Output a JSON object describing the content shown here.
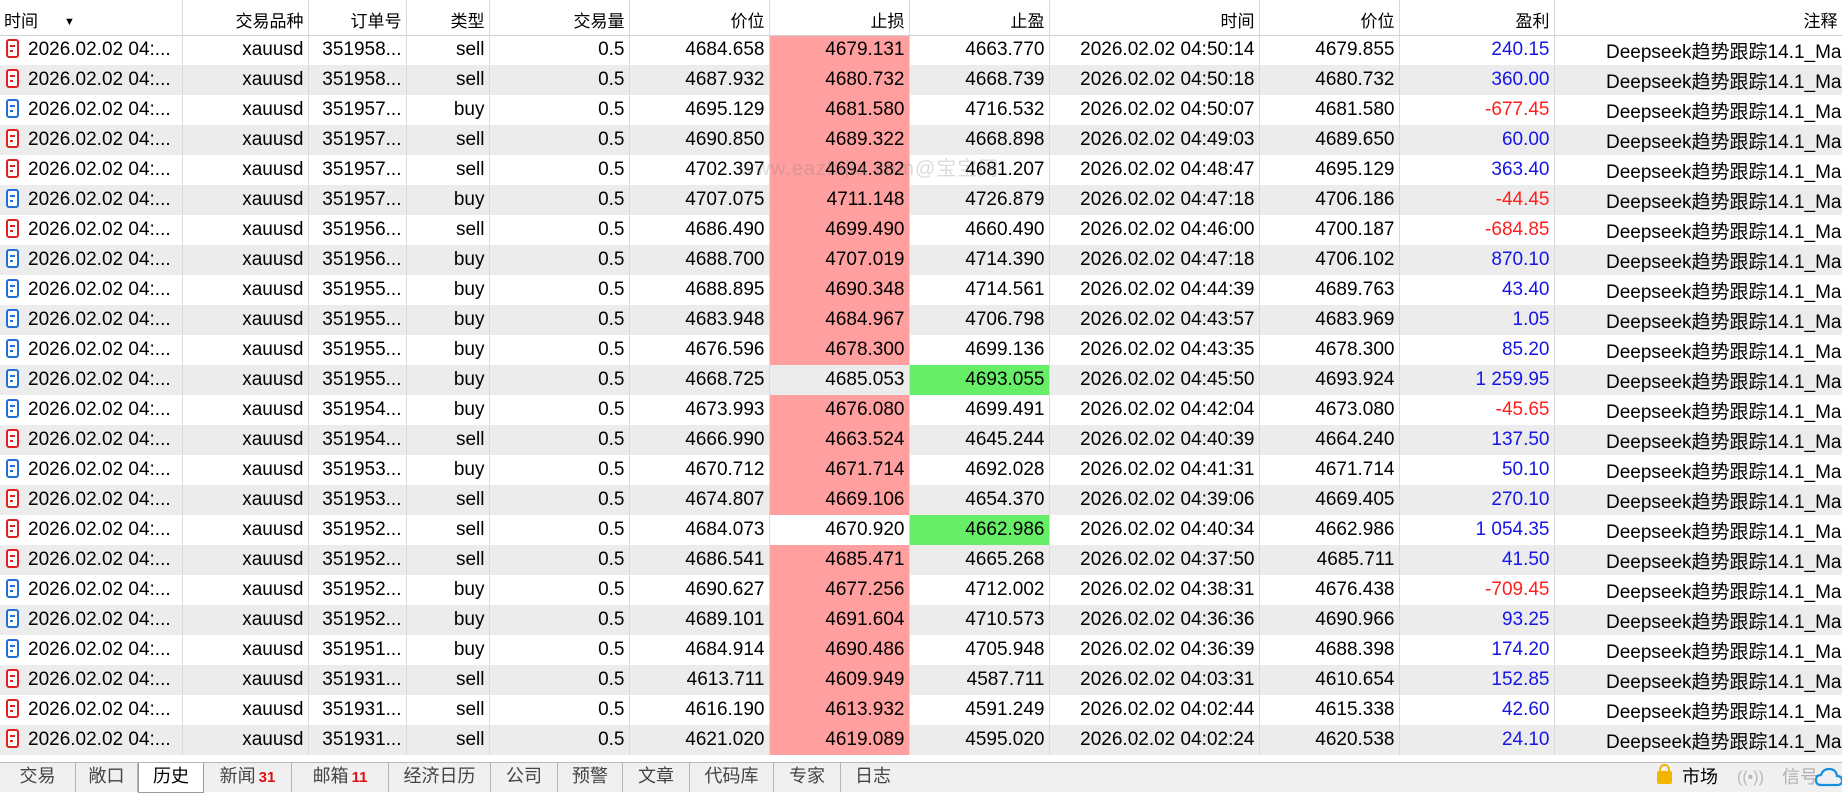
{
  "table": {
    "headers": {
      "time": "时间",
      "symbol": "交易品种",
      "ticket": "订单号",
      "type": "类型",
      "volume": "交易量",
      "price": "价位",
      "sl": "止损",
      "tp": "止盈",
      "close_time": "时间",
      "close_price": "价位",
      "profit": "盈利",
      "comment": "注释"
    },
    "rows": [
      {
        "time": "2026.02.02 04:...",
        "symbol": "xauusd",
        "ticket": "351958...",
        "type": "sell",
        "volume": "0.5",
        "price": "4684.658",
        "sl": "4679.131",
        "tp": "4663.770",
        "close_time": "2026.02.02 04:50:14",
        "close_price": "4679.855",
        "profit": "240.15",
        "comment": "Deepseek趋势跟踪14.1_Ma",
        "closed_by": "sl",
        "profit_sign": "pos"
      },
      {
        "time": "2026.02.02 04:...",
        "symbol": "xauusd",
        "ticket": "351958...",
        "type": "sell",
        "volume": "0.5",
        "price": "4687.932",
        "sl": "4680.732",
        "tp": "4668.739",
        "close_time": "2026.02.02 04:50:18",
        "close_price": "4680.732",
        "profit": "360.00",
        "comment": "Deepseek趋势跟踪14.1_Ma",
        "closed_by": "sl",
        "profit_sign": "pos"
      },
      {
        "time": "2026.02.02 04:...",
        "symbol": "xauusd",
        "ticket": "351957...",
        "type": "buy",
        "volume": "0.5",
        "price": "4695.129",
        "sl": "4681.580",
        "tp": "4716.532",
        "close_time": "2026.02.02 04:50:07",
        "close_price": "4681.580",
        "profit": "-677.45",
        "comment": "Deepseek趋势跟踪14.1_Ma",
        "closed_by": "sl",
        "profit_sign": "neg"
      },
      {
        "time": "2026.02.02 04:...",
        "symbol": "xauusd",
        "ticket": "351957...",
        "type": "sell",
        "volume": "0.5",
        "price": "4690.850",
        "sl": "4689.322",
        "tp": "4668.898",
        "close_time": "2026.02.02 04:49:03",
        "close_price": "4689.650",
        "profit": "60.00",
        "comment": "Deepseek趋势跟踪14.1_Ma",
        "closed_by": "sl",
        "profit_sign": "pos"
      },
      {
        "time": "2026.02.02 04:...",
        "symbol": "xauusd",
        "ticket": "351957...",
        "type": "sell",
        "volume": "0.5",
        "price": "4702.397",
        "sl": "4694.382",
        "tp": "4681.207",
        "close_time": "2026.02.02 04:48:47",
        "close_price": "4695.129",
        "profit": "363.40",
        "comment": "Deepseek趋势跟踪14.1_Ma",
        "closed_by": "sl",
        "profit_sign": "pos"
      },
      {
        "time": "2026.02.02 04:...",
        "symbol": "xauusd",
        "ticket": "351957...",
        "type": "buy",
        "volume": "0.5",
        "price": "4707.075",
        "sl": "4711.148",
        "tp": "4726.879",
        "close_time": "2026.02.02 04:47:18",
        "close_price": "4706.186",
        "profit": "-44.45",
        "comment": "Deepseek趋势跟踪14.1_Ma",
        "closed_by": "sl",
        "profit_sign": "neg"
      },
      {
        "time": "2026.02.02 04:...",
        "symbol": "xauusd",
        "ticket": "351956...",
        "type": "sell",
        "volume": "0.5",
        "price": "4686.490",
        "sl": "4699.490",
        "tp": "4660.490",
        "close_time": "2026.02.02 04:46:00",
        "close_price": "4700.187",
        "profit": "-684.85",
        "comment": "Deepseek趋势跟踪14.1_Ma",
        "closed_by": "sl",
        "profit_sign": "neg"
      },
      {
        "time": "2026.02.02 04:...",
        "symbol": "xauusd",
        "ticket": "351956...",
        "type": "buy",
        "volume": "0.5",
        "price": "4688.700",
        "sl": "4707.019",
        "tp": "4714.390",
        "close_time": "2026.02.02 04:47:18",
        "close_price": "4706.102",
        "profit": "870.10",
        "comment": "Deepseek趋势跟踪14.1_Ma",
        "closed_by": "sl",
        "profit_sign": "pos"
      },
      {
        "time": "2026.02.02 04:...",
        "symbol": "xauusd",
        "ticket": "351955...",
        "type": "buy",
        "volume": "0.5",
        "price": "4688.895",
        "sl": "4690.348",
        "tp": "4714.561",
        "close_time": "2026.02.02 04:44:39",
        "close_price": "4689.763",
        "profit": "43.40",
        "comment": "Deepseek趋势跟踪14.1_Ma",
        "closed_by": "sl",
        "profit_sign": "pos"
      },
      {
        "time": "2026.02.02 04:...",
        "symbol": "xauusd",
        "ticket": "351955...",
        "type": "buy",
        "volume": "0.5",
        "price": "4683.948",
        "sl": "4684.967",
        "tp": "4706.798",
        "close_time": "2026.02.02 04:43:57",
        "close_price": "4683.969",
        "profit": "1.05",
        "comment": "Deepseek趋势跟踪14.1_Ma",
        "closed_by": "sl",
        "profit_sign": "pos"
      },
      {
        "time": "2026.02.02 04:...",
        "symbol": "xauusd",
        "ticket": "351955...",
        "type": "buy",
        "volume": "0.5",
        "price": "4676.596",
        "sl": "4678.300",
        "tp": "4699.136",
        "close_time": "2026.02.02 04:43:35",
        "close_price": "4678.300",
        "profit": "85.20",
        "comment": "Deepseek趋势跟踪14.1_Ma",
        "closed_by": "sl",
        "profit_sign": "pos"
      },
      {
        "time": "2026.02.02 04:...",
        "symbol": "xauusd",
        "ticket": "351955...",
        "type": "buy",
        "volume": "0.5",
        "price": "4668.725",
        "sl": "4685.053",
        "tp": "4693.055",
        "close_time": "2026.02.02 04:45:50",
        "close_price": "4693.924",
        "profit": "1 259.95",
        "comment": "Deepseek趋势跟踪14.1_Ma",
        "closed_by": "tp",
        "profit_sign": "pos"
      },
      {
        "time": "2026.02.02 04:...",
        "symbol": "xauusd",
        "ticket": "351954...",
        "type": "buy",
        "volume": "0.5",
        "price": "4673.993",
        "sl": "4676.080",
        "tp": "4699.491",
        "close_time": "2026.02.02 04:42:04",
        "close_price": "4673.080",
        "profit": "-45.65",
        "comment": "Deepseek趋势跟踪14.1_Ma",
        "closed_by": "sl",
        "profit_sign": "neg"
      },
      {
        "time": "2026.02.02 04:...",
        "symbol": "xauusd",
        "ticket": "351954...",
        "type": "sell",
        "volume": "0.5",
        "price": "4666.990",
        "sl": "4663.524",
        "tp": "4645.244",
        "close_time": "2026.02.02 04:40:39",
        "close_price": "4664.240",
        "profit": "137.50",
        "comment": "Deepseek趋势跟踪14.1_Ma",
        "closed_by": "sl",
        "profit_sign": "pos"
      },
      {
        "time": "2026.02.02 04:...",
        "symbol": "xauusd",
        "ticket": "351953...",
        "type": "buy",
        "volume": "0.5",
        "price": "4670.712",
        "sl": "4671.714",
        "tp": "4692.028",
        "close_time": "2026.02.02 04:41:31",
        "close_price": "4671.714",
        "profit": "50.10",
        "comment": "Deepseek趋势跟踪14.1_Ma",
        "closed_by": "sl",
        "profit_sign": "pos"
      },
      {
        "time": "2026.02.02 04:...",
        "symbol": "xauusd",
        "ticket": "351953...",
        "type": "sell",
        "volume": "0.5",
        "price": "4674.807",
        "sl": "4669.106",
        "tp": "4654.370",
        "close_time": "2026.02.02 04:39:06",
        "close_price": "4669.405",
        "profit": "270.10",
        "comment": "Deepseek趋势跟踪14.1_Ma",
        "closed_by": "sl",
        "profit_sign": "pos"
      },
      {
        "time": "2026.02.02 04:...",
        "symbol": "xauusd",
        "ticket": "351952...",
        "type": "sell",
        "volume": "0.5",
        "price": "4684.073",
        "sl": "4670.920",
        "tp": "4662.986",
        "close_time": "2026.02.02 04:40:34",
        "close_price": "4662.986",
        "profit": "1 054.35",
        "comment": "Deepseek趋势跟踪14.1_Ma",
        "closed_by": "tp",
        "profit_sign": "pos"
      },
      {
        "time": "2026.02.02 04:...",
        "symbol": "xauusd",
        "ticket": "351952...",
        "type": "sell",
        "volume": "0.5",
        "price": "4686.541",
        "sl": "4685.471",
        "tp": "4665.268",
        "close_time": "2026.02.02 04:37:50",
        "close_price": "4685.711",
        "profit": "41.50",
        "comment": "Deepseek趋势跟踪14.1_Ma",
        "closed_by": "sl",
        "profit_sign": "pos"
      },
      {
        "time": "2026.02.02 04:...",
        "symbol": "xauusd",
        "ticket": "351952...",
        "type": "buy",
        "volume": "0.5",
        "price": "4690.627",
        "sl": "4677.256",
        "tp": "4712.002",
        "close_time": "2026.02.02 04:38:31",
        "close_price": "4676.438",
        "profit": "-709.45",
        "comment": "Deepseek趋势跟踪14.1_Ma",
        "closed_by": "sl",
        "profit_sign": "neg"
      },
      {
        "time": "2026.02.02 04:...",
        "symbol": "xauusd",
        "ticket": "351952...",
        "type": "buy",
        "volume": "0.5",
        "price": "4689.101",
        "sl": "4691.604",
        "tp": "4710.573",
        "close_time": "2026.02.02 04:36:36",
        "close_price": "4690.966",
        "profit": "93.25",
        "comment": "Deepseek趋势跟踪14.1_Ma",
        "closed_by": "sl",
        "profit_sign": "pos"
      },
      {
        "time": "2026.02.02 04:...",
        "symbol": "xauusd",
        "ticket": "351951...",
        "type": "buy",
        "volume": "0.5",
        "price": "4684.914",
        "sl": "4690.486",
        "tp": "4705.948",
        "close_time": "2026.02.02 04:36:39",
        "close_price": "4688.398",
        "profit": "174.20",
        "comment": "Deepseek趋势跟踪14.1_Ma",
        "closed_by": "sl",
        "profit_sign": "pos"
      },
      {
        "time": "2026.02.02 04:...",
        "symbol": "xauusd",
        "ticket": "351931...",
        "type": "sell",
        "volume": "0.5",
        "price": "4613.711",
        "sl": "4609.949",
        "tp": "4587.711",
        "close_time": "2026.02.02 04:03:31",
        "close_price": "4610.654",
        "profit": "152.85",
        "comment": "Deepseek趋势跟踪14.1_Ma",
        "closed_by": "sl",
        "profit_sign": "pos"
      },
      {
        "time": "2026.02.02 04:...",
        "symbol": "xauusd",
        "ticket": "351931...",
        "type": "sell",
        "volume": "0.5",
        "price": "4616.190",
        "sl": "4613.932",
        "tp": "4591.249",
        "close_time": "2026.02.02 04:02:44",
        "close_price": "4615.338",
        "profit": "42.60",
        "comment": "Deepseek趋势跟踪14.1_Ma",
        "closed_by": "sl",
        "profit_sign": "pos"
      },
      {
        "time": "2026.02.02 04:...",
        "symbol": "xauusd",
        "ticket": "351931...",
        "type": "sell",
        "volume": "0.5",
        "price": "4621.020",
        "sl": "4619.089",
        "tp": "4595.020",
        "close_time": "2026.02.02 04:02:24",
        "close_price": "4620.538",
        "profit": "24.10",
        "comment": "Deepseek趋势跟踪14.1_Ma",
        "closed_by": "sl",
        "profit_sign": "pos"
      }
    ]
  },
  "watermark": "www.eazhijia.com@宝宝网",
  "tabs": [
    {
      "label": "交易",
      "badge": ""
    },
    {
      "label": "敞口",
      "badge": ""
    },
    {
      "label": "历史",
      "badge": "",
      "active": true
    },
    {
      "label": "新闻",
      "badge": "31"
    },
    {
      "label": "邮箱",
      "badge": "11"
    },
    {
      "label": "经济日历",
      "badge": ""
    },
    {
      "label": "公司",
      "badge": ""
    },
    {
      "label": "预警",
      "badge": ""
    },
    {
      "label": "文章",
      "badge": ""
    },
    {
      "label": "代码库",
      "badge": ""
    },
    {
      "label": "专家",
      "badge": ""
    },
    {
      "label": "日志",
      "badge": ""
    }
  ],
  "status": {
    "market_label": "市场",
    "signal_label": "信号",
    "market_icon": "lock-icon",
    "signal_icon": "broadcast-icon",
    "cloud_icon": "cloud-icon"
  },
  "colors": {
    "sl_hit": "#ff9f9f",
    "tp_hit": "#66ef66",
    "profit_positive": "#1515e8",
    "profit_negative": "#ff1f1f",
    "sell_icon": "#e02020",
    "buy_icon": "#1f6fd8",
    "badge": "#e01010"
  }
}
